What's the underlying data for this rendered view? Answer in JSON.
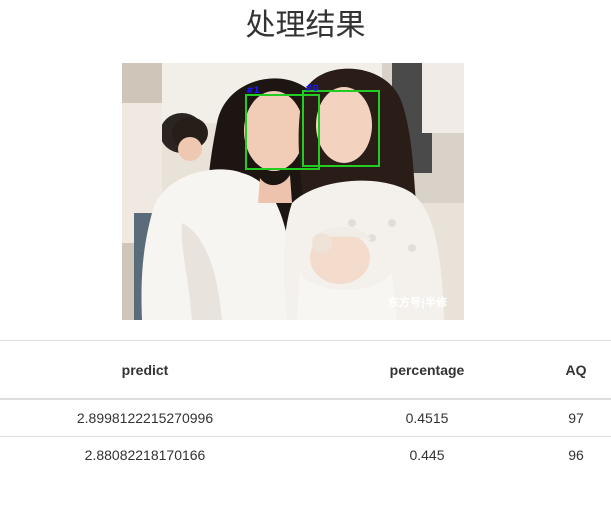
{
  "page": {
    "title": "处理结果"
  },
  "image": {
    "watermark": "东方号|半修",
    "face_labels": [
      "#1",
      "#0"
    ],
    "box_color": "#22cc22",
    "label_color": "#1a1aff"
  },
  "table": {
    "headers": {
      "predict": "predict",
      "percentage": "percentage",
      "aq": "AQ"
    },
    "rows": [
      {
        "predict": "2.8998122215270996",
        "percentage": "0.4515",
        "aq": "97"
      },
      {
        "predict": "2.88082218170166",
        "percentage": "0.445",
        "aq": "96"
      }
    ]
  }
}
